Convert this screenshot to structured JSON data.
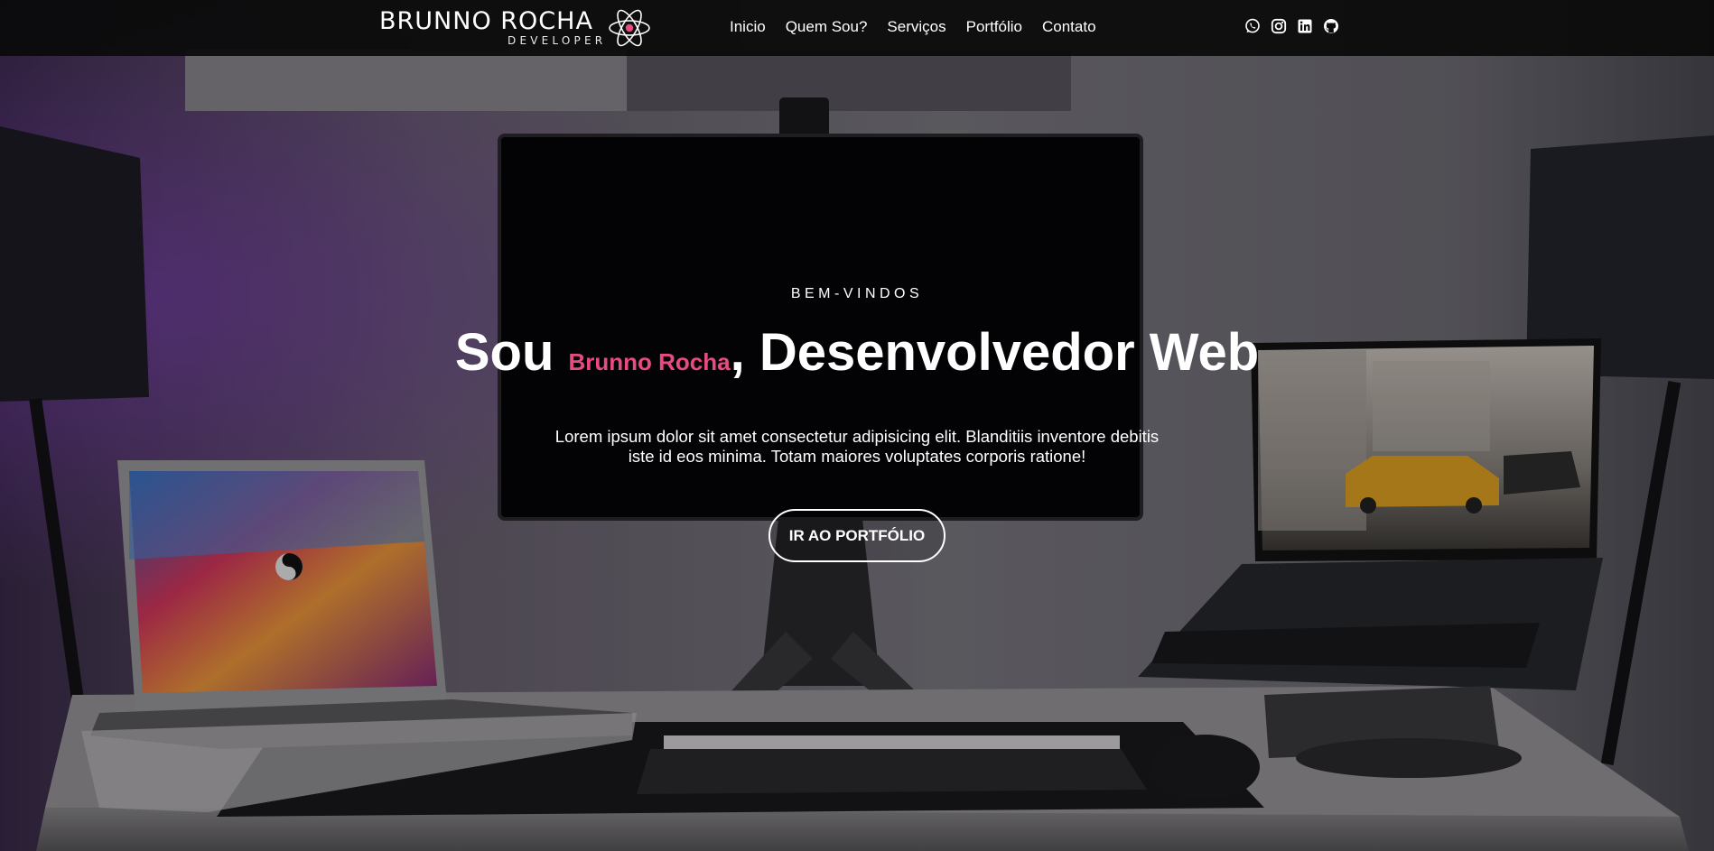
{
  "brand": {
    "name": "BRUNNO ROCHA",
    "tagline": "DEVELOPER"
  },
  "nav": {
    "items": [
      {
        "label": "Inicio"
      },
      {
        "label": "Quem Sou?"
      },
      {
        "label": "Serviços"
      },
      {
        "label": "Portfólio"
      },
      {
        "label": "Contato"
      }
    ]
  },
  "social": {
    "icons": [
      "whatsapp-icon",
      "instagram-icon",
      "linkedin-icon",
      "github-icon"
    ]
  },
  "hero": {
    "kicker": "BEM-VINDOS",
    "title_prefix": "Sou ",
    "title_name": "Brunno Rocha",
    "title_suffix": ", Desenvolvedor Web",
    "description": "Lorem ipsum dolor sit amet consectetur adipisicing elit. Blanditiis inventore debitis iste id eos minima. Totam maiores voluptates corporis ratione!",
    "cta_label": "IR AO PORTFÓLIO"
  },
  "colors": {
    "accent": "#e84b7f",
    "navbar_bg": "#0a0a0a",
    "text": "#ffffff"
  }
}
